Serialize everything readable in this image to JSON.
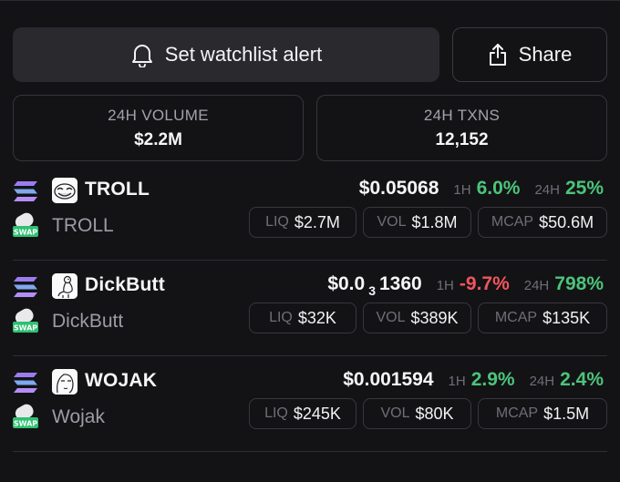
{
  "actions": {
    "alert_label": "Set watchlist alert",
    "share_label": "Share"
  },
  "stats": {
    "volume": {
      "label": "24H VOLUME",
      "value": "$2.2M"
    },
    "txns": {
      "label": "24H TXNS",
      "value": "12,152"
    }
  },
  "labels": {
    "h1": "1H",
    "h24": "24H",
    "liq": "LIQ",
    "vol": "VOL",
    "mcap": "MCAP",
    "dex_badge": "SWAP"
  },
  "colors": {
    "positive": "#4cc47a",
    "negative": "#f0565a",
    "chain_solana": "#9a7cf0"
  },
  "tokens": [
    {
      "symbol": "TROLL",
      "name": "TROLL",
      "logo_icon": "troll-face-icon",
      "price": {
        "prefix": "$0.05068",
        "sub": "",
        "rest": ""
      },
      "change_1h": "6.0%",
      "change_1h_dir": "up",
      "change_24h": "25%",
      "change_24h_dir": "up",
      "liq": "$2.7M",
      "vol": "$1.8M",
      "mcap": "$50.6M"
    },
    {
      "symbol": "DickButt",
      "name": "DickButt",
      "logo_icon": "dickbutt-drawing-icon",
      "price": {
        "prefix": "$0.0",
        "sub": "3",
        "rest": "1360"
      },
      "change_1h": "-9.7%",
      "change_1h_dir": "down",
      "change_24h": "798%",
      "change_24h_dir": "up",
      "liq": "$32K",
      "vol": "$389K",
      "mcap": "$135K"
    },
    {
      "symbol": "WOJAK",
      "name": "Wojak",
      "logo_icon": "wojak-face-icon",
      "price": {
        "prefix": "$0.001594",
        "sub": "",
        "rest": ""
      },
      "change_1h": "2.9%",
      "change_1h_dir": "up",
      "change_24h": "2.4%",
      "change_24h_dir": "up",
      "liq": "$245K",
      "vol": "$80K",
      "mcap": "$1.5M"
    }
  ]
}
